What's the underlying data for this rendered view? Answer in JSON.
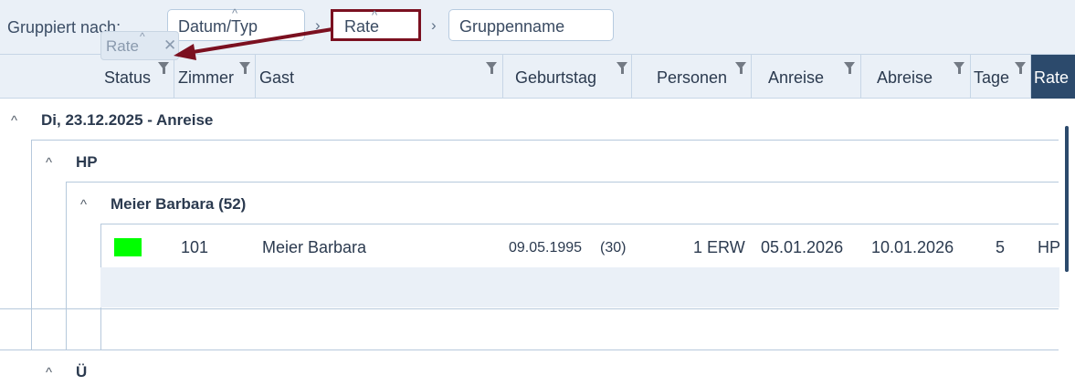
{
  "groupbar": {
    "label": "Gruppiert nach:",
    "chips": [
      {
        "label": "Datum/Typ",
        "caret": "^"
      },
      {
        "label": "Rate",
        "caret": "^"
      },
      {
        "label": "Gruppenname"
      }
    ],
    "separator": "›",
    "dragged_chip": {
      "label": "Rate",
      "caret": "^",
      "close": "✕"
    },
    "highlight_color": "#7b1020"
  },
  "columns": [
    "Status",
    "Zimmer",
    "Gast",
    "Geburtstag",
    "Personen",
    "Anreise",
    "Abreise",
    "Tage",
    "Rate"
  ],
  "groups": {
    "date_group": "Di, 23.12.2025 - Anreise",
    "rate_group": "HP",
    "guest_group": "Meier Barbara (52)",
    "next_rate_group": "Ü"
  },
  "rows": [
    {
      "status_color": "#00ff00",
      "room": "101",
      "guest": "Meier Barbara",
      "birthday": "09.05.1995",
      "age": "(30)",
      "persons": "1 ERW",
      "arrival": "05.01.2026",
      "departure": "10.01.2026",
      "days": "5",
      "rate": "HP"
    }
  ],
  "icons": {
    "collapse": "^",
    "filter": "filter-icon"
  }
}
